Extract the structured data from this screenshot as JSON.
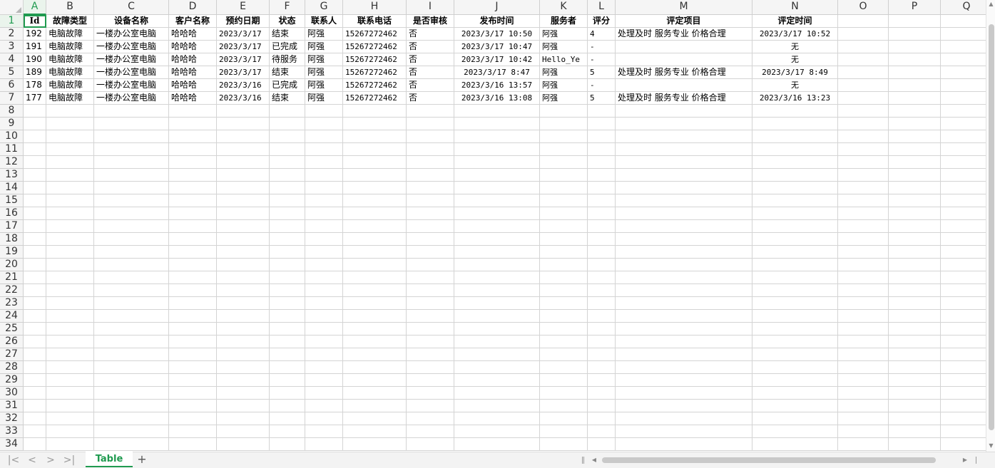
{
  "columns": [
    "A",
    "B",
    "C",
    "D",
    "E",
    "F",
    "G",
    "H",
    "I",
    "J",
    "K",
    "L",
    "M",
    "N",
    "O",
    "P",
    "Q"
  ],
  "header_row": [
    "Id",
    "故障类型",
    "设备名称",
    "客户名称",
    "预约日期",
    "状态",
    "联系人",
    "联系电话",
    "是否审核",
    "发布时间",
    "服务者",
    "评分",
    "评定项目",
    "评定时间",
    "",
    "",
    ""
  ],
  "data_rows": [
    [
      "192",
      "电脑故障",
      "一楼办公室电脑",
      "哈哈哈",
      "2023/3/17",
      "结束",
      "阿强",
      "15267272462",
      "否",
      "2023/3/17 10:50",
      "阿强",
      "4",
      "处理及时 服务专业 价格合理",
      "2023/3/17 10:52",
      "",
      "",
      ""
    ],
    [
      "191",
      "电脑故障",
      "一楼办公室电脑",
      "哈哈哈",
      "2023/3/17",
      "已完成",
      "阿强",
      "15267272462",
      "否",
      "2023/3/17 10:47",
      "阿强",
      "-",
      "",
      "无",
      "",
      "",
      ""
    ],
    [
      "190",
      "电脑故障",
      "一楼办公室电脑",
      "哈哈哈",
      "2023/3/17",
      "待服务",
      "阿强",
      "15267272462",
      "否",
      "2023/3/17 10:42",
      "Hello_Ye",
      "-",
      "",
      "无",
      "",
      "",
      ""
    ],
    [
      "189",
      "电脑故障",
      "一楼办公室电脑",
      "哈哈哈",
      "2023/3/17",
      "结束",
      "阿强",
      "15267272462",
      "否",
      "2023/3/17 8:47",
      "阿强",
      "5",
      "处理及时 服务专业 价格合理",
      "2023/3/17 8:49",
      "",
      "",
      ""
    ],
    [
      "178",
      "电脑故障",
      "一楼办公室电脑",
      "哈哈哈",
      "2023/3/16",
      "已完成",
      "阿强",
      "15267272462",
      "否",
      "2023/3/16 13:57",
      "阿强",
      "-",
      "",
      "无",
      "",
      "",
      ""
    ],
    [
      "177",
      "电脑故障",
      "一楼办公室电脑",
      "哈哈哈",
      "2023/3/16",
      "结束",
      "阿强",
      "15267272462",
      "否",
      "2023/3/16 13:08",
      "阿强",
      "5",
      "处理及时 服务专业 价格合理",
      "2023/3/16 13:23",
      "",
      "",
      ""
    ]
  ],
  "row_count": 34,
  "sheet_tabs": [
    {
      "label": "Table"
    }
  ],
  "nav_icons": [
    "first-sheet-icon",
    "prev-sheet-icon",
    "next-sheet-icon",
    "last-sheet-icon"
  ],
  "add_sheet_icon": "plus-icon",
  "colors": {
    "accent": "#1f9a4f",
    "header_bg": "#f5f5f5",
    "grid": "#d4d4d4"
  }
}
